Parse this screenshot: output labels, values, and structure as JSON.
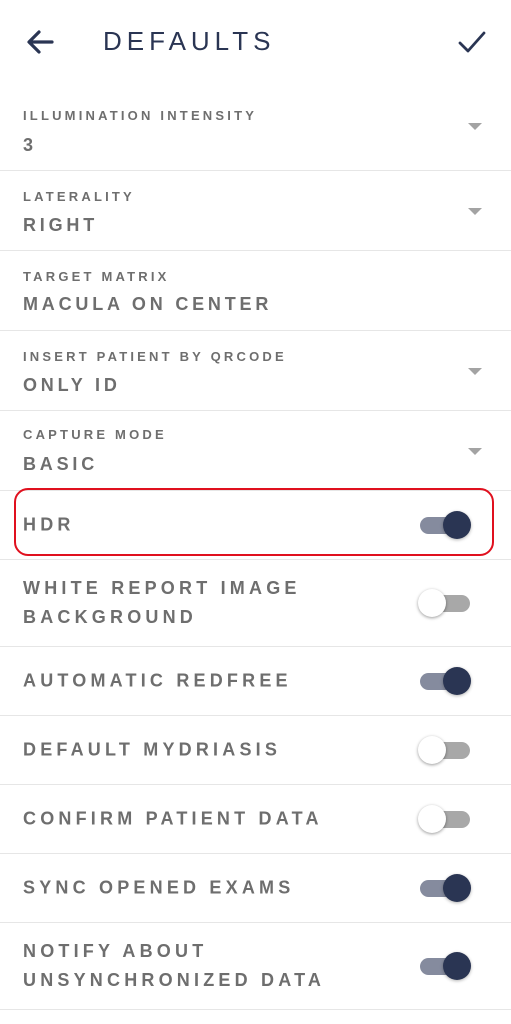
{
  "header": {
    "title": "DEFAULTS",
    "back_icon": "arrow-left-icon",
    "confirm_icon": "check-icon"
  },
  "settings": [
    {
      "label": "ILLUMINATION INTENSITY",
      "value": "3",
      "has_dropdown": true
    },
    {
      "label": "LATERALITY",
      "value": "RIGHT",
      "has_dropdown": true
    },
    {
      "label": "TARGET MATRIX",
      "value": "MACULA ON CENTER",
      "has_dropdown": false
    },
    {
      "label": "INSERT PATIENT BY QRCODE",
      "value": "ONLY ID",
      "has_dropdown": true
    },
    {
      "label": "CAPTURE MODE",
      "value": "BASIC",
      "has_dropdown": true
    }
  ],
  "toggles": [
    {
      "label": "HDR",
      "on": true
    },
    {
      "label": "WHITE REPORT IMAGE BACKGROUND",
      "on": false
    },
    {
      "label": "AUTOMATIC REDFREE",
      "on": true
    },
    {
      "label": "DEFAULT MYDRIASIS",
      "on": false
    },
    {
      "label": "CONFIRM PATIENT DATA",
      "on": false
    },
    {
      "label": "SYNC OPENED EXAMS",
      "on": true
    },
    {
      "label": "NOTIFY ABOUT UNSYNCHRONIZED DATA",
      "on": true
    }
  ],
  "colors": {
    "accent": "#2a3553",
    "highlight": "#e0101e",
    "text": "#6e6e6e",
    "toggle_on_track": "#858b9e",
    "toggle_off_track": "#a8a8a8"
  }
}
